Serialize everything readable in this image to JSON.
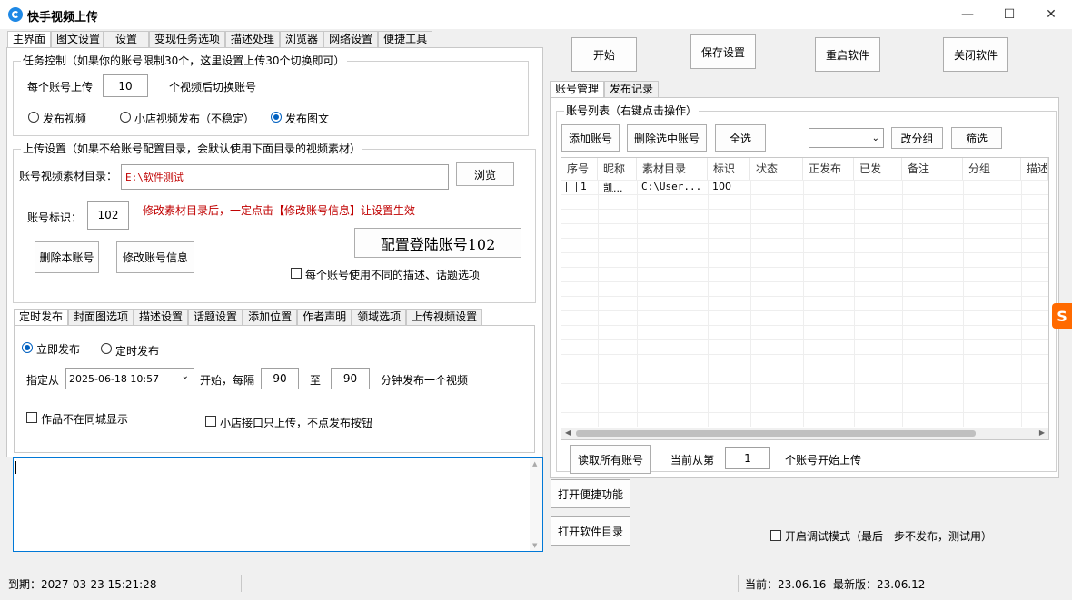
{
  "window": {
    "title": "快手视频上传",
    "minimize": "—",
    "maximize": "☐",
    "close": "✕"
  },
  "main_tabs": [
    "主界面",
    "图文设置",
    "设置",
    "变现任务选项",
    "描述处理",
    "浏览器",
    "网络设置",
    "便捷工具"
  ],
  "task_control": {
    "title": "任务控制（如果你的账号限制30个，这里设置上传30个切换即可）",
    "per_account_label": "每个账号上传",
    "per_account_value": "10",
    "after_label": "个视频后切换账号",
    "radio_video": "发布视频",
    "radio_shop": "小店视频发布（不稳定）",
    "radio_image": "发布图文"
  },
  "upload_settings": {
    "title": "上传设置（如果不给账号配置目录，会默认使用下面目录的视频素材）",
    "dir_label": "账号视频素材目录：",
    "dir_value": "E:\\软件测试",
    "browse": "浏览",
    "id_label": "账号标识：",
    "id_value": "102",
    "warning": "修改素材目录后，一定点击【修改账号信息】让设置生效",
    "config_login": "配置登陆账号102",
    "delete_account": "删除本账号",
    "modify_account": "修改账号信息",
    "diff_desc": "每个账号使用不同的描述、话题选项"
  },
  "sub_tabs": [
    "定时发布",
    "封面图选项",
    "描述设置",
    "话题设置",
    "添加位置",
    "作者声明",
    "领域选项",
    "上传视频设置"
  ],
  "schedule": {
    "immediate": "立即发布",
    "timed": "定时发布",
    "from_label": "指定从",
    "datetime": "2025-06-18 10:57",
    "start_label": "开始，每隔",
    "interval_min": "90",
    "to_label": "至",
    "interval_max": "90",
    "unit_label": "分钟发布一个视频",
    "not_local": "作品不在同城显示",
    "shop_only": "小店接口只上传，不点发布按钮"
  },
  "top_buttons": {
    "start": "开始",
    "save": "保存设置",
    "restart": "重启软件",
    "close": "关闭软件"
  },
  "right_tabs": [
    "账号管理",
    "发布记录"
  ],
  "accounts": {
    "title": "账号列表（右键点击操作）",
    "add": "添加账号",
    "delete_selected": "删除选中账号",
    "select_all": "全选",
    "change_group": "改分组",
    "filter": "筛选",
    "columns": [
      "序号",
      "昵称",
      "素材目录",
      "标识",
      "状态",
      "正发布",
      "已发",
      "备注",
      "分组",
      "描述"
    ],
    "rows": [
      {
        "index": "1",
        "nickname": "凯...",
        "dir": "C:\\User...",
        "id": "100"
      }
    ],
    "read_all": "读取所有账号",
    "current_from": "当前从第",
    "current_value": "1",
    "current_suffix": "个账号开始上传"
  },
  "bottom_buttons": {
    "quick": "打开便捷功能",
    "open_dir": "打开软件目录"
  },
  "debug_mode": "开启调试模式（最后一步不发布，测试用）",
  "status": {
    "expire": "到期：2027-03-23 15:21:28",
    "current": "当前：23.06.16",
    "latest": "最新版：23.06.12"
  }
}
